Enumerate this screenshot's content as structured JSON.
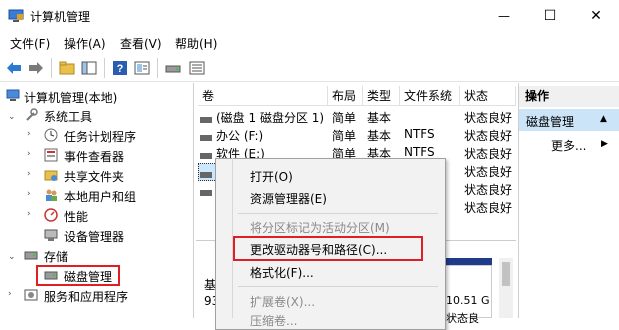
{
  "window": {
    "title": "计算机管理",
    "controls": {
      "minimize": "—",
      "maximize": "☐",
      "close": "✕"
    }
  },
  "menu": [
    "文件(F)",
    "操作(A)",
    "查看(V)",
    "帮助(H)"
  ],
  "toolbar": {
    "icons": [
      "back-arrow-icon",
      "forward-arrow-icon",
      "up-folder-icon",
      "show-hide-tree-icon",
      "help-icon",
      "properties-icon",
      "disk-icon",
      "list-icon"
    ]
  },
  "tree": {
    "root": "计算机管理(本地)",
    "system_tools": "系统工具",
    "task_scheduler": "任务计划程序",
    "event_viewer": "事件查看器",
    "shared_folders": "共享文件夹",
    "local_users": "本地用户和组",
    "performance": "性能",
    "device_manager": "设备管理器",
    "storage": "存储",
    "disk_management": "磁盘管理",
    "services_apps": "服务和应用程序"
  },
  "volume_table": {
    "headers": [
      "卷",
      "布局",
      "类型",
      "文件系统",
      "状态"
    ],
    "rows": [
      {
        "volume": "(磁盘 1 磁盘分区 1)",
        "layout": "简单",
        "type": "基本",
        "fs": "",
        "status": "状态良好"
      },
      {
        "volume": "办公 (F:)",
        "layout": "简单",
        "type": "基本",
        "fs": "NTFS",
        "status": "状态良好"
      },
      {
        "volume": "软件 (E:)",
        "layout": "简单",
        "type": "基本",
        "fs": "NTFS",
        "status": "状态良好"
      },
      {
        "volume": "",
        "layout": "",
        "type": "",
        "fs": "",
        "status": "状态良好"
      },
      {
        "volume": "",
        "layout": "",
        "type": "",
        "fs": "",
        "status": "状态良好"
      },
      {
        "volume": "",
        "layout": "",
        "type": "",
        "fs": "",
        "status": "状态良好"
      }
    ]
  },
  "disk_area": {
    "label_fragment": "基",
    "size_fragment": "93",
    "right_fragment_1": "10.51 G",
    "right_fragment_2": "状态良"
  },
  "context_menu": {
    "open": "打开(O)",
    "explorer": "资源管理器(E)",
    "mark_active": "将分区标记为活动分区(M)",
    "change_letter": "更改驱动器号和路径(C)...",
    "format": "格式化(F)...",
    "extend": "扩展卷(X)...",
    "shrink_fragment": "压缩卷..."
  },
  "actions": {
    "header": "操作",
    "section": "磁盘管理",
    "more": "更多..."
  },
  "colors": {
    "selection": "#cce8ff",
    "highlight_box": "#e02020",
    "disk_bar": "#1f3b8a"
  }
}
